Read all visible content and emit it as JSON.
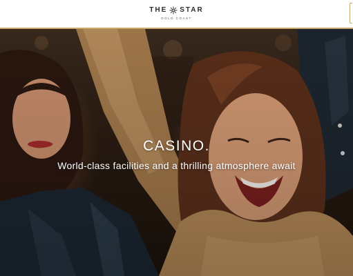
{
  "header": {
    "logo_left": "THE",
    "logo_right": "STAR",
    "logo_sub": "GOLD COAST",
    "logo_icon": "star-burst-icon"
  },
  "hero": {
    "title": "CASINO.",
    "subtitle": "World-class facilities and a thrilling atmosphere await"
  },
  "colors": {
    "header_bg": "#ffffff",
    "accent_gold": "#c9a96a",
    "hero_text": "#ffffff"
  }
}
